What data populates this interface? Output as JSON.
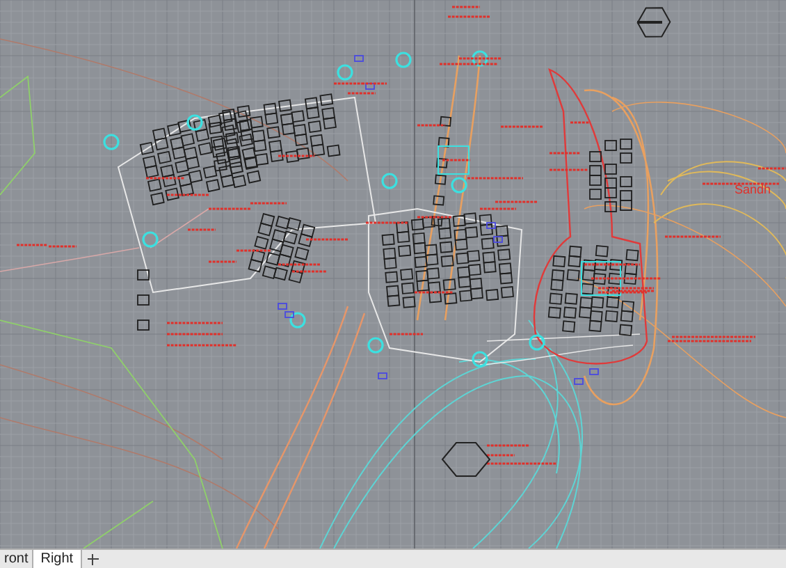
{
  "viewport": {
    "labels": [
      {
        "text": "Sandh"
      }
    ]
  },
  "tabs": [
    {
      "label": "ront",
      "selected": false
    },
    {
      "label": "Right",
      "selected": true
    }
  ]
}
